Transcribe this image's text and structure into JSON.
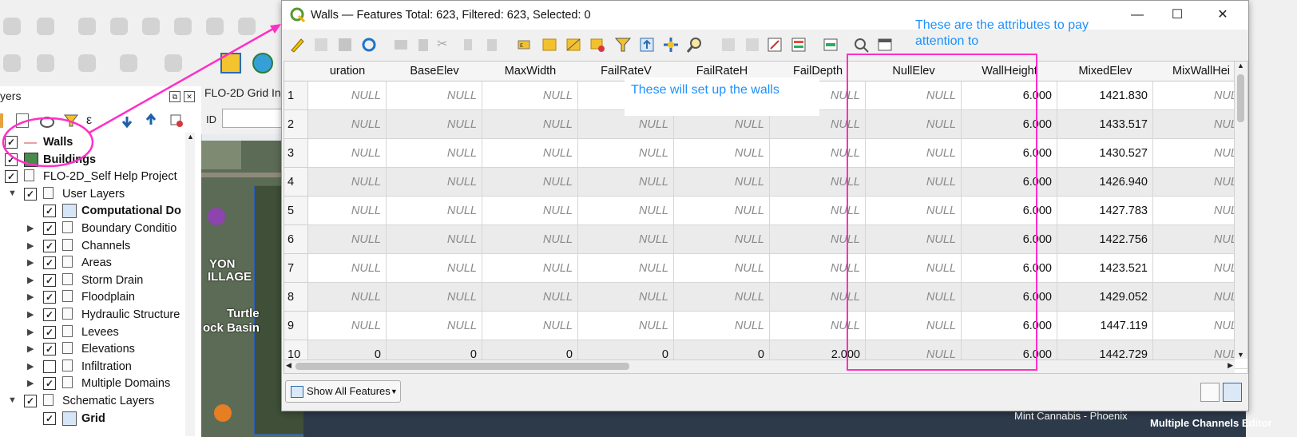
{
  "layers_panel": {
    "title_partial": "yers",
    "items": [
      {
        "label": "Walls",
        "bold": true,
        "checked": true,
        "icon": "line-layer-icon",
        "indent": 0,
        "arrow": ""
      },
      {
        "label": "Buildings",
        "bold": true,
        "checked": true,
        "icon": "polygon-fill-green-icon",
        "indent": 0,
        "arrow": ""
      },
      {
        "label": "FLO-2D_Self Help Project",
        "bold": false,
        "checked": true,
        "icon": "group-icon",
        "indent": 0,
        "arrow": ""
      },
      {
        "label": "User Layers",
        "bold": false,
        "checked": true,
        "icon": "group-icon",
        "indent": 1,
        "arrow": "▼"
      },
      {
        "label": "Computational Do",
        "bold": true,
        "checked": true,
        "icon": "polygon-outline-icon",
        "indent": 2,
        "arrow": ""
      },
      {
        "label": "Boundary Conditio",
        "bold": false,
        "checked": true,
        "icon": "group-icon",
        "indent": 2,
        "arrow": "▶"
      },
      {
        "label": "Channels",
        "bold": false,
        "checked": true,
        "icon": "group-icon",
        "indent": 2,
        "arrow": "▶"
      },
      {
        "label": "Areas",
        "bold": false,
        "checked": true,
        "icon": "group-icon",
        "indent": 2,
        "arrow": "▶"
      },
      {
        "label": "Storm Drain",
        "bold": false,
        "checked": true,
        "icon": "group-icon",
        "indent": 2,
        "arrow": "▶"
      },
      {
        "label": "Floodplain",
        "bold": false,
        "checked": true,
        "icon": "group-icon",
        "indent": 2,
        "arrow": "▶"
      },
      {
        "label": "Hydraulic Structure",
        "bold": false,
        "checked": true,
        "icon": "group-icon",
        "indent": 2,
        "arrow": "▶"
      },
      {
        "label": "Levees",
        "bold": false,
        "checked": true,
        "icon": "group-icon",
        "indent": 2,
        "arrow": "▶"
      },
      {
        "label": "Elevations",
        "bold": false,
        "checked": true,
        "icon": "group-icon",
        "indent": 2,
        "arrow": "▶"
      },
      {
        "label": "Infiltration",
        "bold": false,
        "checked": false,
        "icon": "group-icon",
        "indent": 2,
        "arrow": "▶"
      },
      {
        "label": "Multiple Domains",
        "bold": false,
        "checked": true,
        "icon": "group-icon",
        "indent": 2,
        "arrow": "▶"
      },
      {
        "label": "Schematic Layers",
        "bold": false,
        "checked": true,
        "icon": "group-icon",
        "indent": 1,
        "arrow": "▼"
      },
      {
        "label": "Grid",
        "bold": true,
        "checked": true,
        "icon": "polygon-outline-icon",
        "indent": 2,
        "arrow": ""
      }
    ]
  },
  "grid_panel": {
    "title_partial": "FLO-2D Grid In",
    "id_label": "ID"
  },
  "map": {
    "labels": [
      "YON",
      "ILLAGE",
      "Turtle",
      "ock Basin"
    ]
  },
  "status": {
    "multiple_channels_editor": "Multiple Channels Editor",
    "map_text": "Mint Cannabis - Phoenix"
  },
  "dialog": {
    "title": "Walls — Features Total: 623, Filtered: 623, Selected: 0",
    "show_all_label": "Show All Features",
    "columns": [
      "uration",
      "BaseElev",
      "MaxWidth",
      "FailRateV",
      "FailRateH",
      "FailDepth",
      "NullElev",
      "WallHeight",
      "MixedElev",
      "MixWallHei"
    ],
    "rows": [
      {
        "id": "1",
        "cells": [
          "NULL",
          "NULL",
          "NULL",
          "NULL",
          "NULL",
          "NULL",
          "NULL",
          "6.000",
          "1421.830",
          "NULL"
        ]
      },
      {
        "id": "2",
        "cells": [
          "NULL",
          "NULL",
          "NULL",
          "NULL",
          "NULL",
          "NULL",
          "NULL",
          "6.000",
          "1433.517",
          "NULL"
        ]
      },
      {
        "id": "3",
        "cells": [
          "NULL",
          "NULL",
          "NULL",
          "NULL",
          "NULL",
          "NULL",
          "NULL",
          "6.000",
          "1430.527",
          "NULL"
        ]
      },
      {
        "id": "4",
        "cells": [
          "NULL",
          "NULL",
          "NULL",
          "NULL",
          "NULL",
          "NULL",
          "NULL",
          "6.000",
          "1426.940",
          "NULL"
        ]
      },
      {
        "id": "5",
        "cells": [
          "NULL",
          "NULL",
          "NULL",
          "NULL",
          "NULL",
          "NULL",
          "NULL",
          "6.000",
          "1427.783",
          "NULL"
        ]
      },
      {
        "id": "6",
        "cells": [
          "NULL",
          "NULL",
          "NULL",
          "NULL",
          "NULL",
          "NULL",
          "NULL",
          "6.000",
          "1422.756",
          "NULL"
        ]
      },
      {
        "id": "7",
        "cells": [
          "NULL",
          "NULL",
          "NULL",
          "NULL",
          "NULL",
          "NULL",
          "NULL",
          "6.000",
          "1423.521",
          "NULL"
        ]
      },
      {
        "id": "8",
        "cells": [
          "NULL",
          "NULL",
          "NULL",
          "NULL",
          "NULL",
          "NULL",
          "NULL",
          "6.000",
          "1429.052",
          "NULL"
        ]
      },
      {
        "id": "9",
        "cells": [
          "NULL",
          "NULL",
          "NULL",
          "NULL",
          "NULL",
          "NULL",
          "NULL",
          "6.000",
          "1447.119",
          "NULL"
        ]
      },
      {
        "id": "10",
        "cells": [
          "0",
          "0",
          "0",
          "0",
          "0",
          "2.000",
          "NULL",
          "6.000",
          "1442.729",
          "NULL"
        ]
      }
    ]
  },
  "annotations": {
    "attributes_note": "These are the attributes to pay attention to",
    "walls_note": "These will set up the walls",
    "highlight_color": "#ff2fc6",
    "text_color": "#1e90ff"
  },
  "colors": {
    "alt_row": "#ebebeb",
    "null_text": "#8a8a8a",
    "qgis_green": "#589632"
  }
}
